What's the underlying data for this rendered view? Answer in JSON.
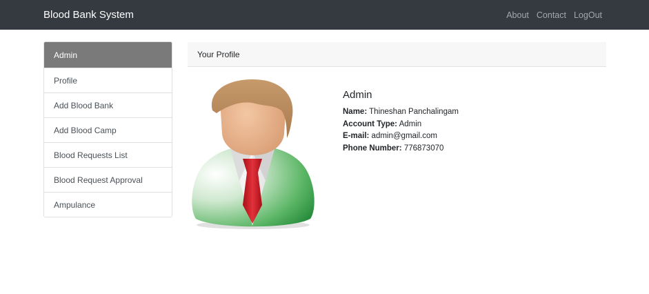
{
  "navbar": {
    "brand": "Blood Bank System",
    "links": [
      "About",
      "Contact",
      "LogOut"
    ]
  },
  "sidebar": {
    "items": [
      {
        "label": "Admin",
        "active": true
      },
      {
        "label": "Profile"
      },
      {
        "label": "Add Blood Bank"
      },
      {
        "label": "Add Blood Camp"
      },
      {
        "label": "Blood Requests List"
      },
      {
        "label": "Blood Request Approval"
      },
      {
        "label": "Ampulance"
      }
    ]
  },
  "main": {
    "header": "Your Profile",
    "avatar_icon": "user-avatar-icon",
    "profile": {
      "title": "Admin",
      "name_label": "Name:",
      "name": "Thineshan Panchalingam",
      "account_type_label": "Account Type:",
      "account_type": "Admin",
      "email_label": "E-mail:",
      "email": "admin@gmail.com",
      "phone_label": "Phone Number:",
      "phone": "776873070"
    }
  },
  "colors": {
    "navbar_bg": "#343a40",
    "sidebar_active": "#7a7a7a",
    "tie_red": "#d0202a",
    "jacket_green": "#3a9a48"
  }
}
